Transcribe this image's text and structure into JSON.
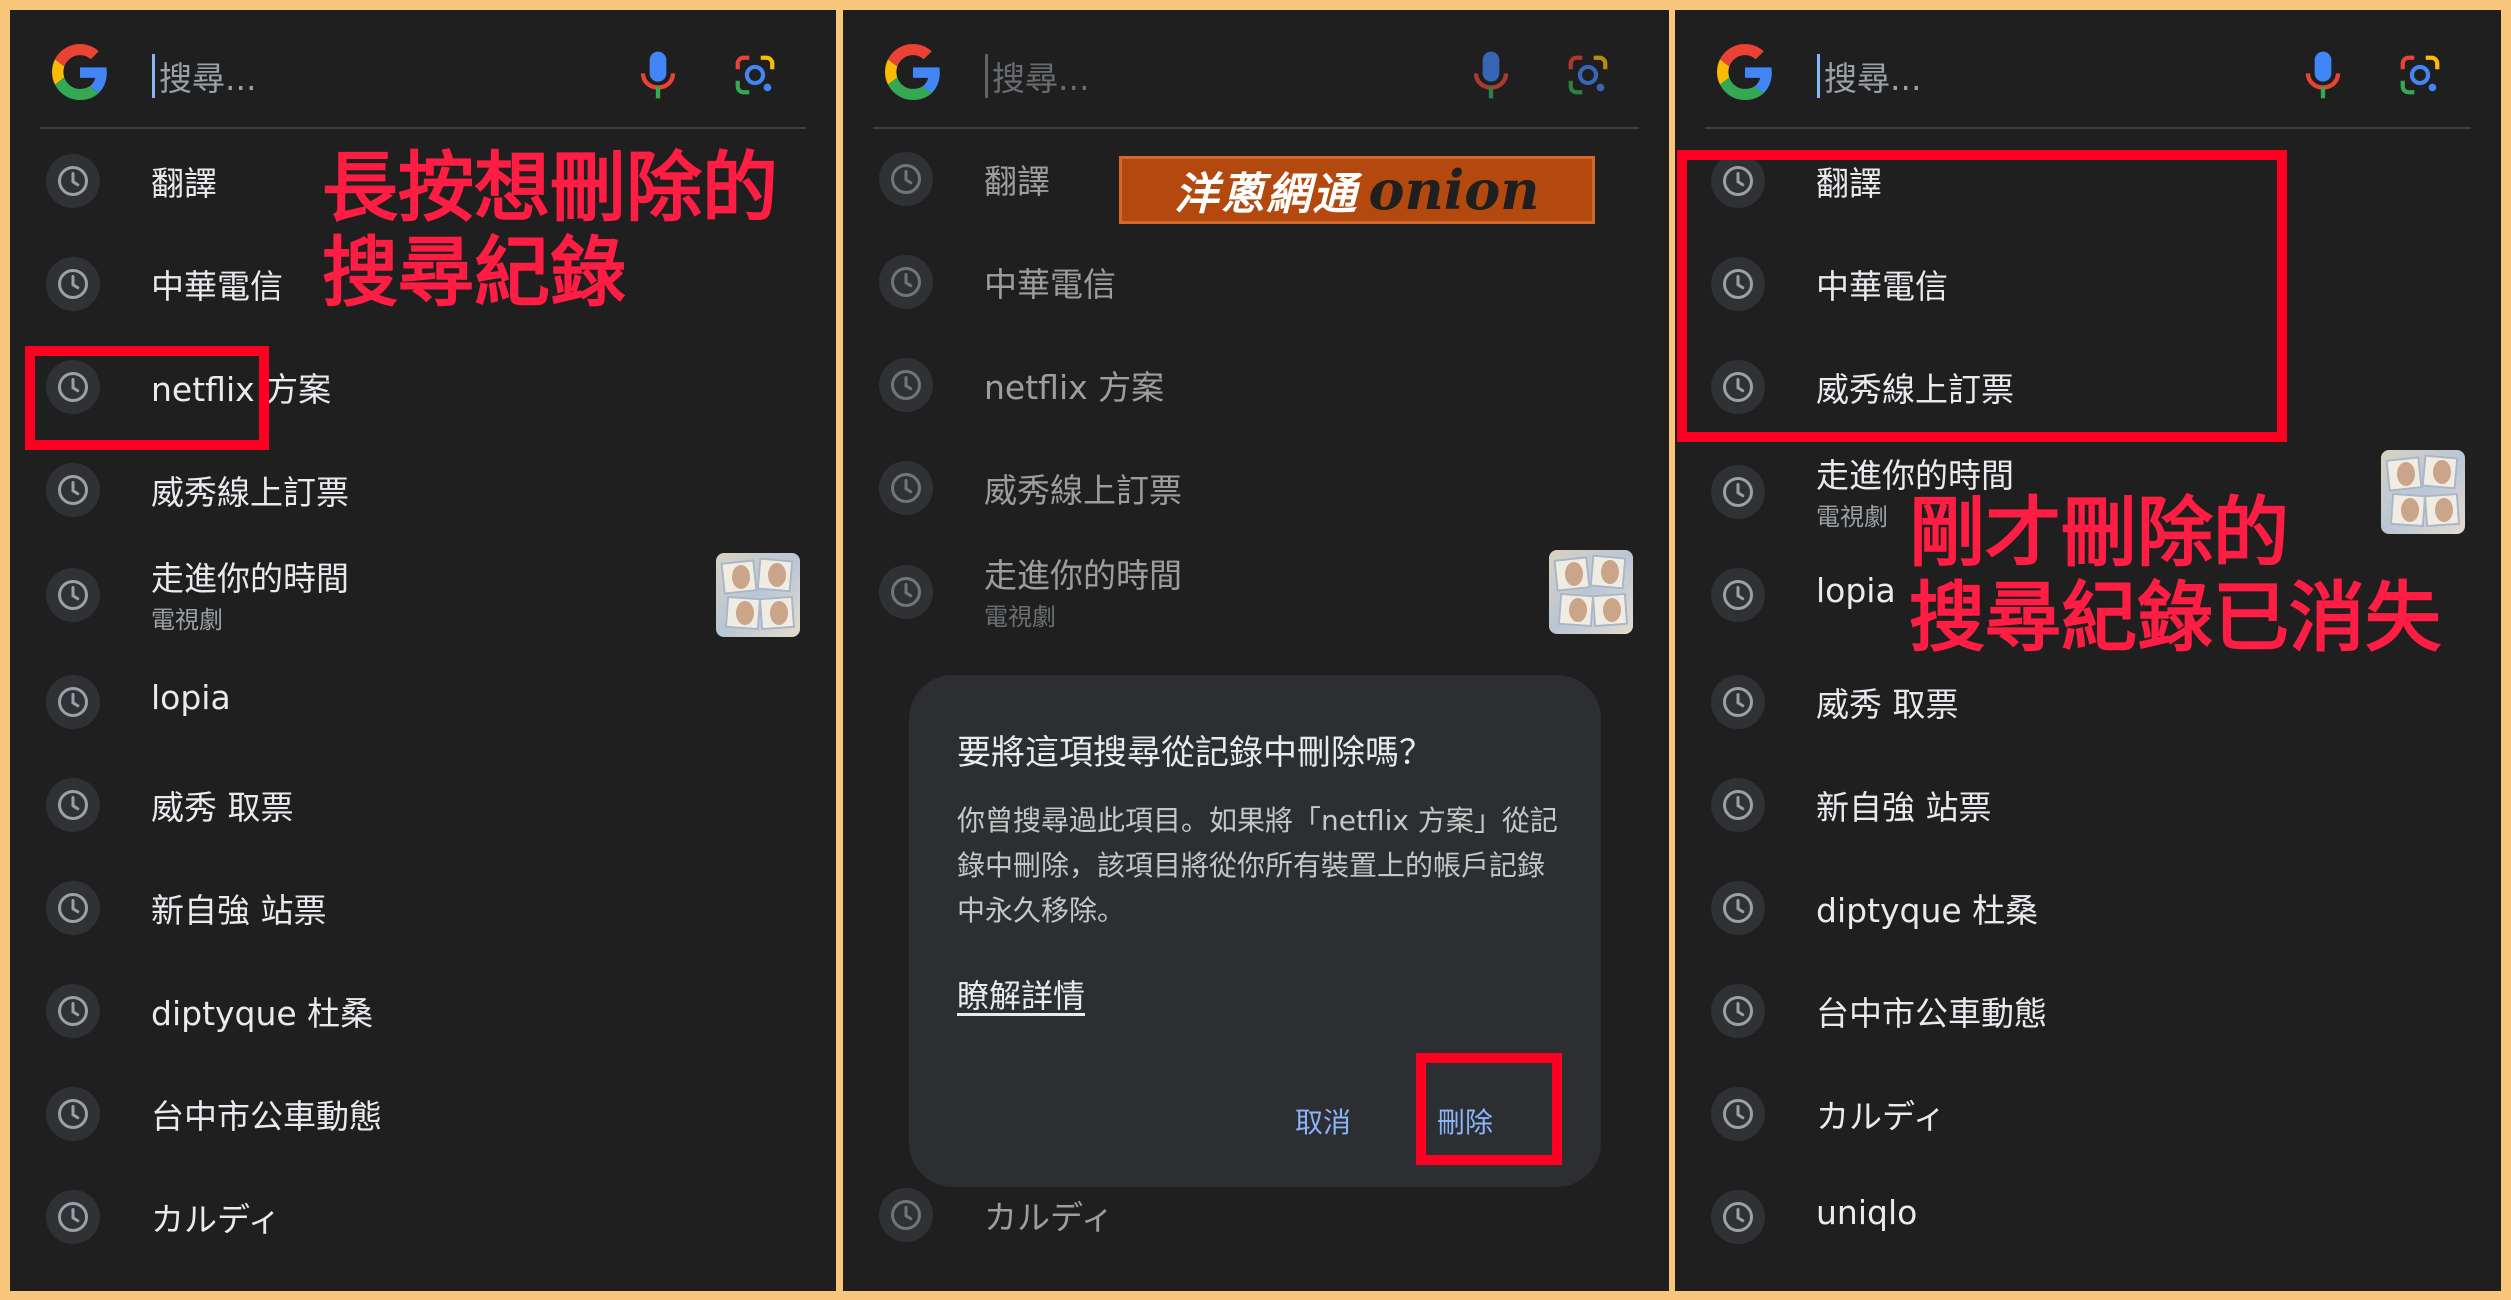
{
  "search": {
    "placeholder": "搜尋..."
  },
  "panel1": {
    "items": [
      {
        "label": "翻譯"
      },
      {
        "label": "中華電信"
      },
      {
        "label": "netflix 方案"
      },
      {
        "label": "威秀線上訂票"
      },
      {
        "label": "走進你的時間",
        "sub": "電視劇"
      },
      {
        "label": "lopia"
      },
      {
        "label": "威秀 取票"
      },
      {
        "label": "新自強 站票"
      },
      {
        "label": "diptyque 杜桑"
      },
      {
        "label": "台中市公車動態"
      },
      {
        "label": "カルディ"
      }
    ],
    "annotation": [
      "長按想刪除的",
      "搜尋紀錄"
    ]
  },
  "panel2": {
    "items": [
      {
        "label": "翻譯"
      },
      {
        "label": "中華電信"
      },
      {
        "label": "netflix 方案"
      },
      {
        "label": "威秀線上訂票"
      },
      {
        "label": "走進你的時間",
        "sub": "電視劇"
      },
      {
        "label": "カルディ"
      }
    ],
    "watermark": {
      "cn": "洋蔥網通",
      "en": "onion"
    },
    "dialog": {
      "title": "要將這項搜尋從記錄中刪除嗎？",
      "body": "你曾搜尋過此項目。如果將「netflix 方案」從記錄中刪除，該項目將從你所有裝置上的帳戶記錄中永久移除。",
      "link": "瞭解詳情",
      "cancel": "取消",
      "delete": "刪除"
    }
  },
  "panel3": {
    "items": [
      {
        "label": "翻譯"
      },
      {
        "label": "中華電信"
      },
      {
        "label": "威秀線上訂票"
      },
      {
        "label": "走進你的時間",
        "sub": "電視劇"
      },
      {
        "label": "lopia"
      },
      {
        "label": "威秀 取票"
      },
      {
        "label": "新自強 站票"
      },
      {
        "label": "diptyque 杜桑"
      },
      {
        "label": "台中市公車動態"
      },
      {
        "label": "カルディ"
      },
      {
        "label": "uniqlo"
      }
    ],
    "annotation": [
      "剛才刪除的",
      "搜尋紀錄已消失"
    ]
  },
  "colors": {
    "frame": "#f9c77c",
    "background": "#1f1f1f",
    "annotation": "#ff1d43",
    "highlight_box": "#ff0022",
    "accent": "#8ab4f8"
  },
  "icons": [
    "google-g-logo",
    "mic-icon",
    "google-lens-icon",
    "history-clock-icon"
  ]
}
